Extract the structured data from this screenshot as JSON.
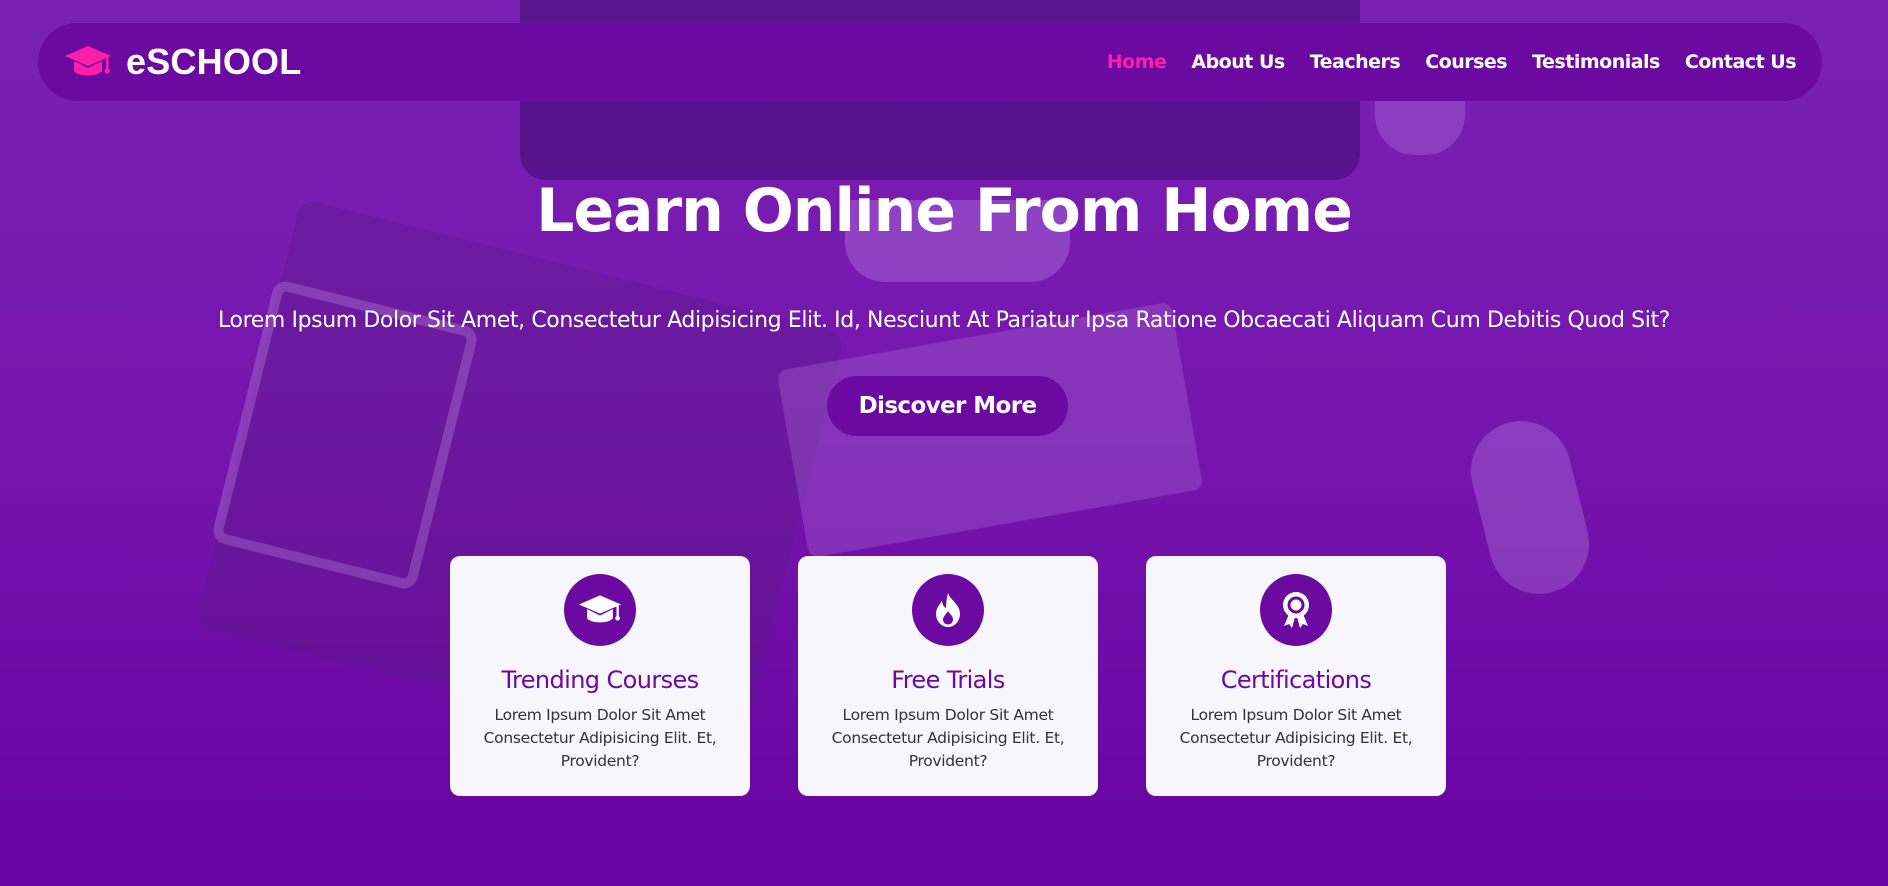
{
  "brand": {
    "name": "eSCHOOL",
    "icon": "graduation-cap-icon"
  },
  "nav": {
    "items": [
      {
        "label": "Home",
        "active": true
      },
      {
        "label": "About Us",
        "active": false
      },
      {
        "label": "Teachers",
        "active": false
      },
      {
        "label": "Courses",
        "active": false
      },
      {
        "label": "Testimonials",
        "active": false
      },
      {
        "label": "Contact Us",
        "active": false
      }
    ]
  },
  "hero": {
    "title": "Learn Online From Home",
    "subtitle": "Lorem Ipsum Dolor Sit Amet, Consectetur Adipisicing Elit. Id, Nesciunt At Pariatur Ipsa Ratione Obcaecati Aliquam Cum Debitis Quod Sit?",
    "cta_label": "Discover More"
  },
  "features": [
    {
      "icon": "graduation-cap-icon",
      "title": "Trending Courses",
      "text": "Lorem Ipsum Dolor Sit Amet Consectetur Adipisicing Elit. Et, Provident?"
    },
    {
      "icon": "fire-icon",
      "title": "Free Trials",
      "text": "Lorem Ipsum Dolor Sit Amet Consectetur Adipisicing Elit. Et, Provident?"
    },
    {
      "icon": "award-icon",
      "title": "Certifications",
      "text": "Lorem Ipsum Dolor Sit Amet Consectetur Adipisicing Elit. Et, Provident?"
    }
  ],
  "colors": {
    "primary": "#6a0aa0",
    "accent": "#ff1ea8",
    "card_background": "#f6f6fc",
    "overlay": "#7e1ebe"
  }
}
